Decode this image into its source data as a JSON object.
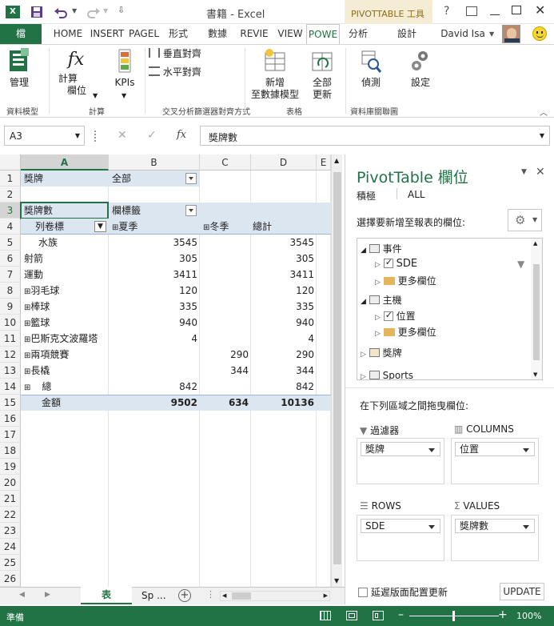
{
  "window": {
    "title": "書籍 - Excel",
    "context_tab_title": "PIVOTTABLE 工具",
    "help": "?",
    "user": "David Isa"
  },
  "tabs": [
    "檔",
    "HOME",
    "INSERT",
    "PAGEL",
    "形式",
    "數據",
    "REVIE",
    "VIEW",
    "POWE",
    "分析",
    "設計"
  ],
  "ribbon": {
    "manage": "管理",
    "calc_fields_1": "計算",
    "calc_fields_2": "欄位",
    "kpis": "KPIs",
    "vertical": "垂直對齊",
    "horizontal": "水平對齊",
    "add_model_1": "新增",
    "add_model_2": "至數據模型",
    "refresh_all_1": "全部",
    "refresh_all_2": "更新",
    "detect": "偵測",
    "settings": "設定",
    "groups": [
      "資料模型",
      "計算",
      "交叉分析篩選器對齊方式",
      "表格",
      "資料庫關聯圖"
    ]
  },
  "formula_bar": {
    "name_box": "A3",
    "fx": "fx",
    "value": "獎牌數"
  },
  "grid": {
    "columns": [
      "A",
      "B",
      "C",
      "D",
      "E"
    ],
    "rows": [
      "1",
      "2",
      "3",
      "4",
      "5",
      "6",
      "7",
      "8",
      "9",
      "10",
      "11",
      "12",
      "13",
      "14",
      "15",
      "16",
      "17",
      "18",
      "19",
      "20",
      "21",
      "22",
      "23",
      "24",
      "25",
      "26"
    ],
    "r1": {
      "a": "獎牌",
      "b": "全部"
    },
    "r3": {
      "a": "獎牌數",
      "b": "欄標籤"
    },
    "r4": {
      "a": "列卷標",
      "b": "夏季",
      "c": "冬季",
      "d": "總計"
    },
    "data_rows": [
      {
        "label": "水族",
        "exp": "",
        "b": "3545",
        "c": "",
        "d": "3545"
      },
      {
        "label": "射箭",
        "exp": "",
        "b": "305",
        "c": "",
        "d": "305"
      },
      {
        "label": "運動",
        "exp": "",
        "b": "3411",
        "c": "",
        "d": "3411"
      },
      {
        "label": "羽毛球",
        "exp": "⊞",
        "b": "120",
        "c": "",
        "d": "120"
      },
      {
        "label": "棒球",
        "exp": "⊞",
        "b": "335",
        "c": "",
        "d": "335"
      },
      {
        "label": "籃球",
        "exp": "⊞",
        "b": "940",
        "c": "",
        "d": "940"
      },
      {
        "label": "巴斯克文波羅塔",
        "exp": "⊞",
        "b": "4",
        "c": "",
        "d": "4"
      },
      {
        "label": "兩項競賽",
        "exp": "⊞",
        "b": "",
        "c": "290",
        "d": "290"
      },
      {
        "label": "長橇",
        "exp": "⊞",
        "b": "",
        "c": "344",
        "d": "344"
      },
      {
        "label": "總",
        "exp": "⊞",
        "b": "842",
        "c": "",
        "d": "842"
      }
    ],
    "total": {
      "a": "金額",
      "b": "9502",
      "c": "634",
      "d": "10136"
    }
  },
  "panel": {
    "title": "PivotTable 欄位",
    "tab_active": "積極",
    "tab_all": "ALL",
    "choose_label": "選擇要新增至報表的欄位:",
    "tree": {
      "event": "事件",
      "sde": "SDE",
      "more1": "更多欄位",
      "host": "主機",
      "location": "位置",
      "more2": "更多欄位",
      "medal": "獎牌",
      "sports": "Sports"
    },
    "drag_label": "在下列區域之間拖曳欄位:",
    "filters": "過濾器",
    "columns": "COLUMNS",
    "rows": "ROWS",
    "values": "VALUES",
    "filters_item": "獎牌",
    "columns_item": "位置",
    "rows_item": "SDE",
    "values_item": "獎牌數",
    "defer": "延遲版面配置更新",
    "update": "UPDATE"
  },
  "sheet_tabs": {
    "active": "表",
    "other": "Sp",
    "ellipsis": "..."
  },
  "status": {
    "ready": "準備",
    "zoom": "100%"
  }
}
